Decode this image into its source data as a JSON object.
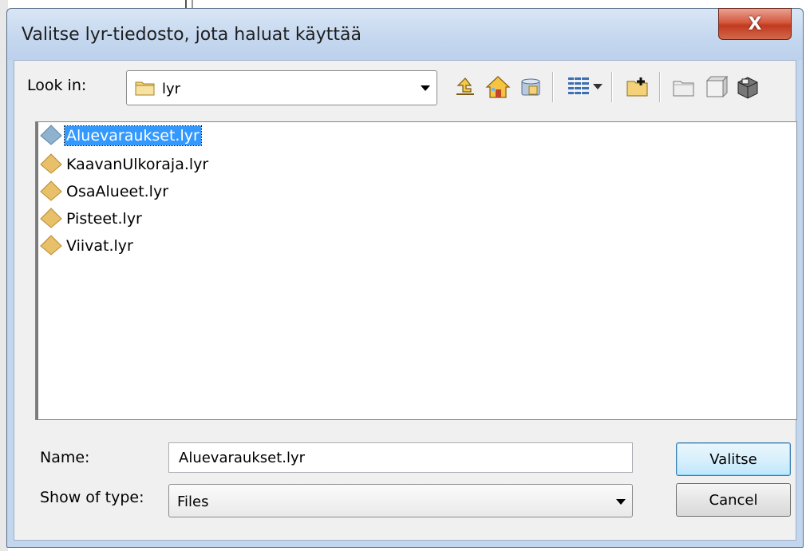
{
  "window": {
    "title": "Valitse lyr-tiedosto, jota haluat käyttää",
    "close_symbol": "X"
  },
  "toolbar": {
    "look_in_label": "Look in:",
    "look_in_value": "lyr",
    "icons": [
      "up-one-level-icon",
      "home-icon",
      "catalog-connections-icon",
      "view-menu-icon",
      "connect-folder-icon",
      "new-folder-icon",
      "new-item-icon",
      "toolbox-icon"
    ]
  },
  "file_list": {
    "items": [
      {
        "name": "Aluevaraukset.lyr",
        "selected": true
      },
      {
        "name": "KaavanUlkoraja.lyr",
        "selected": false
      },
      {
        "name": "OsaAlueet.lyr",
        "selected": false
      },
      {
        "name": "Pisteet.lyr",
        "selected": false
      },
      {
        "name": "Viivat.lyr",
        "selected": false
      }
    ]
  },
  "form": {
    "name_label": "Name:",
    "name_value": "Aluevaraukset.lyr",
    "type_label": "Show of type:",
    "type_value": "Files"
  },
  "buttons": {
    "primary_label": "Valitse",
    "cancel_label": "Cancel"
  },
  "colors": {
    "selection": "#3399ff",
    "layer_icon": "#e8c06a",
    "layer_icon_selected": "#8fb3cf",
    "close_button": "#c9452a"
  }
}
